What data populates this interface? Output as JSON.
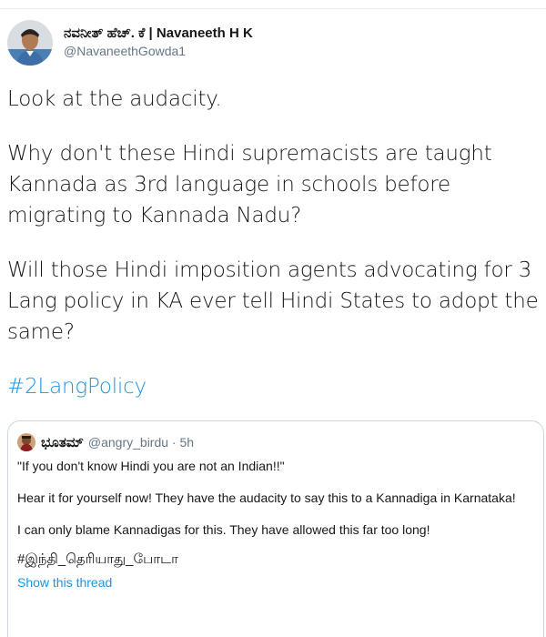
{
  "tweet": {
    "author": {
      "display_name": "ನವನೀತ್ ಹೆಚ್. ಕೆ | Navaneeth H K",
      "handle": "@NavaneethGowda1",
      "avatar_icon": "profile-photo"
    },
    "paragraphs": [
      "Look at the audacity.",
      "Why don't these Hindi supremacists are taught Kannada as 3rd language in schools before migrating to Kannada Nadu?",
      "Will those Hindi imposition agents advocating for 3 Lang policy in KA ever tell Hindi States to adopt the same?"
    ],
    "hashtag": "#2LangPolicy"
  },
  "quoted_tweet": {
    "author": {
      "display_name": "ಭೂತಮ್",
      "handle_meta": "@angry_birdu · 5h",
      "avatar_icon": "profile-photo"
    },
    "paragraphs": [
      "\"If you don't know Hindi you are not an Indian!!\"",
      "Hear it for yourself now! They have the audacity to say this to a Kannadiga in Karnataka!",
      "I can only blame Kannadigas for this. They have allowed this far too long!"
    ],
    "hashtag": "#இந்தி_தெரியாது_போடா",
    "show_thread_label": "Show this thread"
  },
  "colors": {
    "link": "#1b95e0",
    "secondary_text": "#657786",
    "border": "#ccd6dd"
  }
}
